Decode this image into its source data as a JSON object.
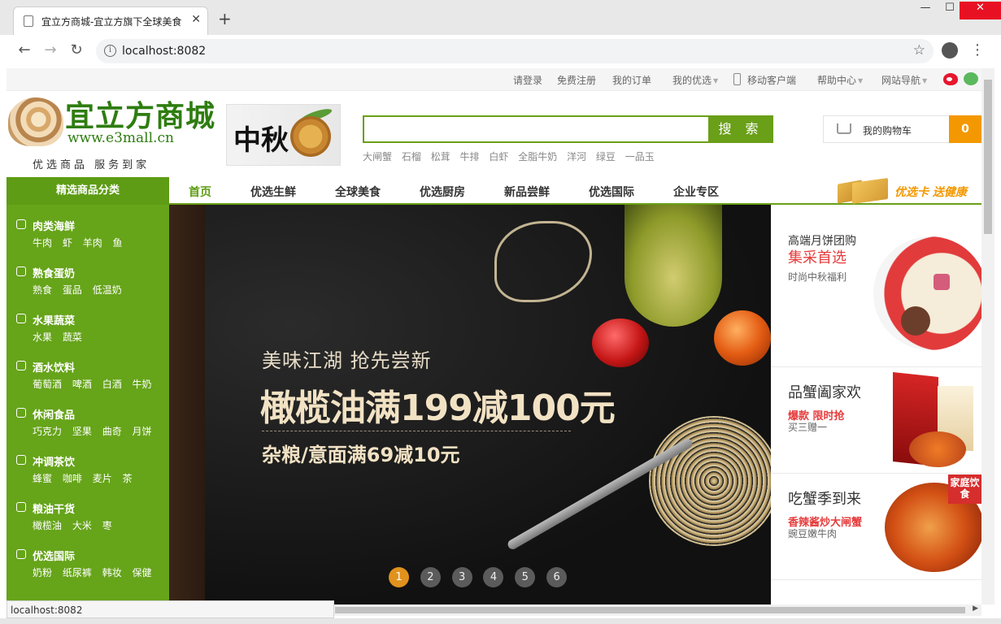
{
  "browser": {
    "tab_title": "宜立方商城-宜立方旗下全球美食",
    "url": "localhost:8082",
    "status_url": "localhost:8082",
    "icons": [
      "back-icon",
      "forward-icon",
      "reload-icon",
      "info-icon",
      "star-icon",
      "profile-icon",
      "menu-icon"
    ]
  },
  "toplinks": {
    "login": "请登录",
    "register": "免费注册",
    "orders": "我的订单",
    "my_picks": "我的优选",
    "mobile": "移动客户端",
    "help": "帮助中心",
    "sitemap": "网站导航"
  },
  "header": {
    "logo_title": "宜立方商城",
    "logo_url": "www.e3mall.cn",
    "logo_slogan": "优选商品  服务到家",
    "mid_autumn_text": "中秋",
    "search": {
      "placeholder": "",
      "button": "搜 索",
      "hotwords": [
        "大闸蟹",
        "石榴",
        "松茸",
        "牛排",
        "白虾",
        "全脂牛奶",
        "洋河",
        "绿豆",
        "一品玉"
      ]
    },
    "cart": {
      "label": "我的购物车",
      "count": "0"
    }
  },
  "nav": {
    "category_title": "精选商品分类",
    "items": [
      "首页",
      "优选生鲜",
      "全球美食",
      "优选厨房",
      "新品尝鲜",
      "优选国际",
      "企业专区"
    ],
    "promo_text": "优选卡 送健康"
  },
  "categories": [
    {
      "name": "肉类海鲜",
      "subs": [
        "牛肉",
        "虾",
        "羊肉",
        "鱼"
      ]
    },
    {
      "name": "熟食蛋奶",
      "subs": [
        "熟食",
        "蛋品",
        "低温奶"
      ]
    },
    {
      "name": "水果蔬菜",
      "subs": [
        "水果",
        "蔬菜"
      ]
    },
    {
      "name": "酒水饮料",
      "subs": [
        "葡萄酒",
        "啤酒",
        "白酒",
        "牛奶"
      ]
    },
    {
      "name": "休闲食品",
      "subs": [
        "巧克力",
        "坚果",
        "曲奇",
        "月饼"
      ]
    },
    {
      "name": "冲调茶饮",
      "subs": [
        "蜂蜜",
        "咖啡",
        "麦片",
        "茶"
      ]
    },
    {
      "name": "粮油干货",
      "subs": [
        "橄榄油",
        "大米",
        "枣"
      ]
    },
    {
      "name": "优选国际",
      "subs": [
        "奶粉",
        "纸尿裤",
        "韩妆",
        "保健"
      ]
    }
  ],
  "banner": {
    "line1": "美味江湖 抢先尝新",
    "line2": "橄榄油满199减100元",
    "line3": "杂粮/意面满69减10元",
    "slides": [
      "1",
      "2",
      "3",
      "4",
      "5",
      "6"
    ],
    "active_slide": 1
  },
  "ads": [
    {
      "title": "高端月饼团购",
      "highlight": "集采首选",
      "sub": "时尚中秋福利"
    },
    {
      "title": "品蟹阖家欢",
      "highlight": "爆款 限时抢",
      "sub": "买三赠一"
    },
    {
      "title": "吃蟹季到来",
      "highlight": "香辣酱炒大闸蟹",
      "sub": "豌豆嫩牛肉",
      "tag": "家庭饮食"
    }
  ]
}
